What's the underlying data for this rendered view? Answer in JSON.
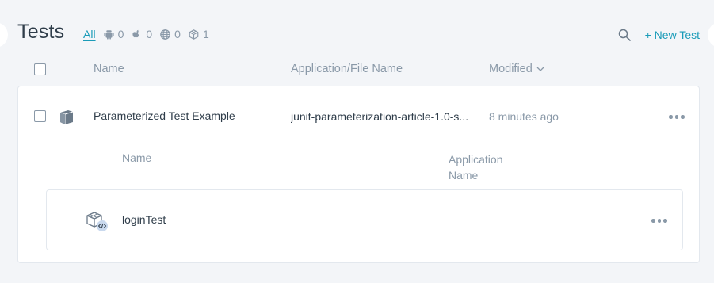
{
  "header": {
    "title": "Tests",
    "filters": {
      "all_label": "All",
      "android_count": "0",
      "apple_count": "0",
      "web_count": "0",
      "other_count": "1"
    },
    "new_test_label": "+ New Test"
  },
  "table": {
    "columns": {
      "name": "Name",
      "application": "Application/File Name",
      "modified": "Modified"
    },
    "rows": [
      {
        "name": "Parameterized Test Example",
        "application": "junit-parameterization-article-1.0-s...",
        "modified": "8 minutes ago",
        "sub_columns": {
          "name": "Name",
          "application_line1": "Application",
          "application_line2": "Name"
        },
        "sub_rows": [
          {
            "name": "loginTest"
          }
        ]
      }
    ]
  },
  "colors": {
    "accent": "#1a9bb8",
    "muted": "#8a99a8",
    "text": "#2f3d4a",
    "background": "#f3f5f8"
  },
  "icons": {
    "filter_icons": [
      "android-icon",
      "apple-icon",
      "globe-icon",
      "cube-icon"
    ],
    "row_icon": "package-box-icon",
    "sub_row_icon": "code-cube-icon"
  }
}
